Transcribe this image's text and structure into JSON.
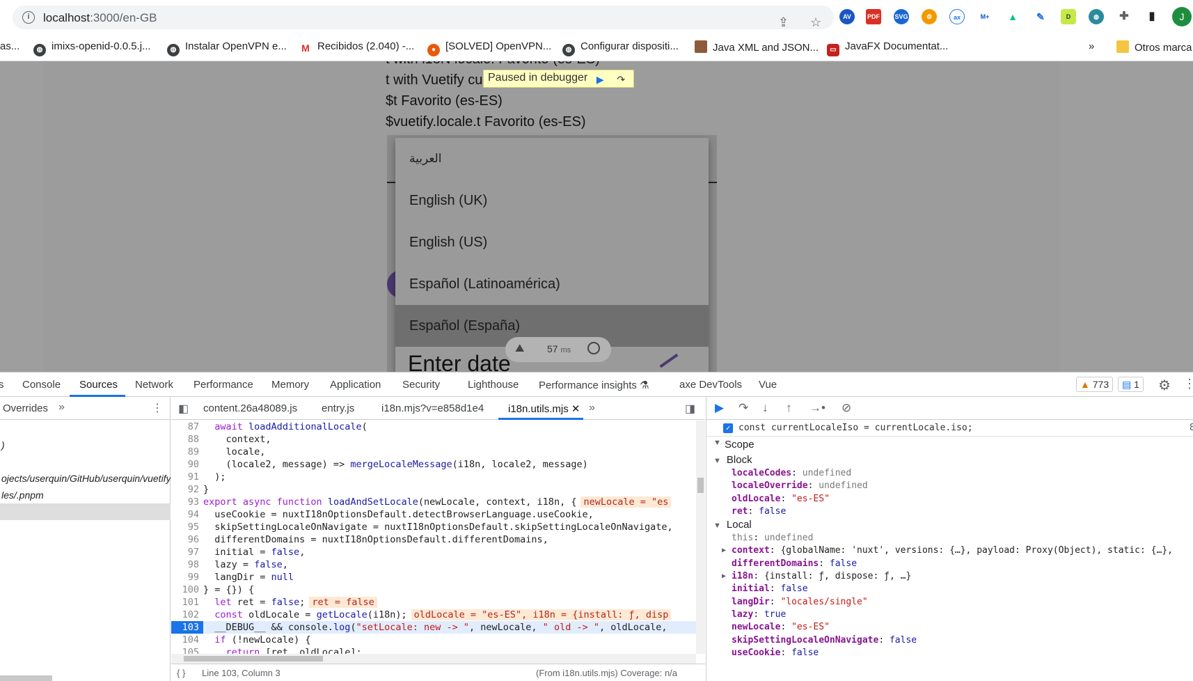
{
  "browser": {
    "url_host": "localhost",
    "url_rest": ":3000/en-GB",
    "avatar_letter": "J",
    "bookmarks": [
      {
        "label": "as...",
        "color": "#555555"
      },
      {
        "label": "imixs-openid-0.0.5.j...",
        "color": "#3c4043"
      },
      {
        "label": "Instalar OpenVPN e...",
        "color": "#3c4043"
      },
      {
        "label": "Recibidos (2.040) -...",
        "color": "#d93025"
      },
      {
        "label": "[SOLVED] OpenVPN...",
        "color": "#e8590c"
      },
      {
        "label": "Configurar dispositi...",
        "color": "#3c4043"
      },
      {
        "label": "Java XML and JSON...",
        "color": "#8d5b3a"
      },
      {
        "label": "JavaFX Documentat...",
        "color": "#c5221f"
      }
    ],
    "overflow_label": "»",
    "other_bookmarks": "Otros marca"
  },
  "page": {
    "lines": [
      "t with i18N locale: Favorito (es-ES)",
      "t with Vuetify cu                        -ES)",
      "$t Favorito (es-ES)",
      "$vuetify.locale.t Favorito (es-ES)"
    ],
    "paused_label": "Paused in debugger",
    "menu_items": [
      {
        "label": "العربية",
        "selected": false
      },
      {
        "label": "English (UK)",
        "selected": false
      },
      {
        "label": "English (US)",
        "selected": false
      },
      {
        "label": "Español (Latinoamérica)",
        "selected": false
      },
      {
        "label": "Español (España)",
        "selected": true
      }
    ],
    "enter_date": "Enter date",
    "timer_value": "57",
    "timer_unit": "ms"
  },
  "devtools": {
    "tabs": [
      "s",
      "Console",
      "Sources",
      "Network",
      "Performance",
      "Memory",
      "Application",
      "Security",
      "Lighthouse",
      "Performance insights",
      "axe DevTools",
      "Vue"
    ],
    "active_tab": "Sources",
    "warnings": "773",
    "infos": "1",
    "navigator": {
      "header": "Overrides",
      "rows": [
        "",
        ")",
        "",
        "ojects/userquin/GitHub/userquin/vuetify",
        "les/.pnpm",
        ""
      ]
    },
    "editor_tabs": [
      "content.26a48089.js",
      "entry.js",
      "i18n.mjs?v=e858d1e4",
      "i18n.utils.mjs"
    ],
    "active_editor_tab": "i18n.utils.mjs",
    "status": {
      "position": "Line 103, Column 3",
      "source": "(From i18n.utils.mjs) Coverage: n/a"
    },
    "breakpoint": {
      "text": "const currentLocaleIso = currentLocale.iso;",
      "line": "8"
    },
    "scope_label": "Scope",
    "scope": {
      "block_label": "Block",
      "block": [
        {
          "name": "localeCodes",
          "value": "undefined",
          "kind": "undef"
        },
        {
          "name": "localeOverride",
          "value": "undefined",
          "kind": "undef"
        },
        {
          "name": "oldLocale",
          "value": "\"es-ES\"",
          "kind": "str"
        },
        {
          "name": "ret",
          "value": "false",
          "kind": "lit"
        }
      ],
      "local_label": "Local",
      "local": [
        {
          "name": "this",
          "value": "undefined",
          "kind": "undef",
          "plain": true
        },
        {
          "name": "context",
          "value": "{globalName: 'nuxt', versions: {…}, payload: Proxy(Object), static: {…},",
          "kind": "obj",
          "expand": true
        },
        {
          "name": "differentDomains",
          "value": "false",
          "kind": "lit"
        },
        {
          "name": "i18n",
          "value": "{install: ƒ, dispose: ƒ, …}",
          "kind": "obj",
          "expand": true
        },
        {
          "name": "initial",
          "value": "false",
          "kind": "lit"
        },
        {
          "name": "langDir",
          "value": "\"locales/single\"",
          "kind": "str"
        },
        {
          "name": "lazy",
          "value": "true",
          "kind": "lit"
        },
        {
          "name": "newLocale",
          "value": "\"es-ES\"",
          "kind": "str"
        },
        {
          "name": "skipSettingLocaleOnNavigate",
          "value": "false",
          "kind": "lit"
        },
        {
          "name": "useCookie",
          "value": "false",
          "kind": "lit"
        }
      ]
    }
  }
}
